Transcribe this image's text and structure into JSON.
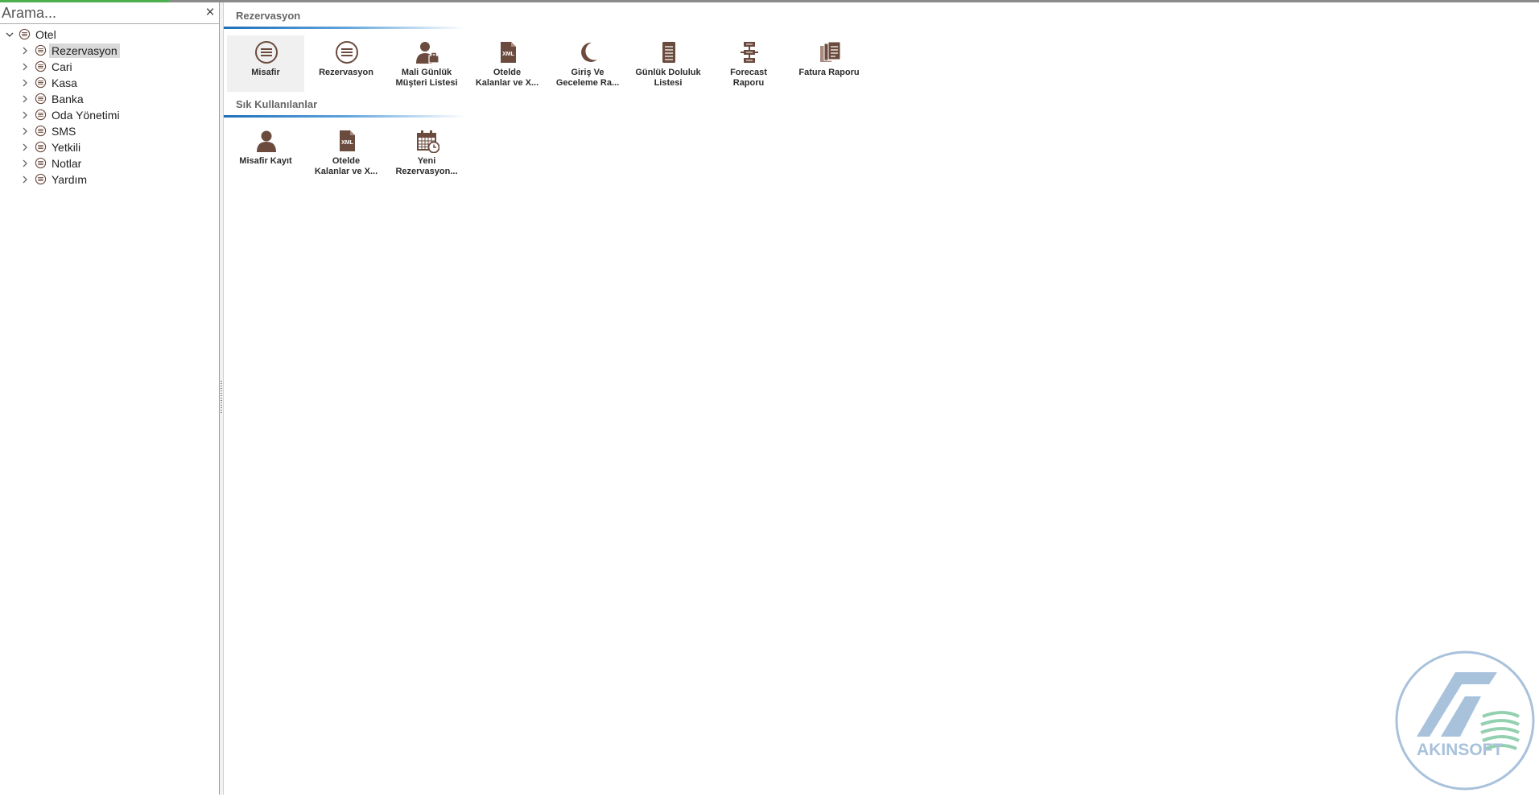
{
  "search": {
    "placeholder": "Arama...",
    "close_symbol": "×"
  },
  "tree": {
    "root": "Otel",
    "items": [
      {
        "label": "Rezervasyon",
        "selected": true
      },
      {
        "label": "Cari"
      },
      {
        "label": "Kasa"
      },
      {
        "label": "Banka"
      },
      {
        "label": "Oda Yönetimi"
      },
      {
        "label": "SMS"
      },
      {
        "label": "Yetkili"
      },
      {
        "label": "Notlar"
      },
      {
        "label": "Yardım"
      }
    ]
  },
  "sections": {
    "main": {
      "title": "Rezervasyon",
      "tiles": [
        {
          "line1": "Misafir",
          "line2": "",
          "icon": "list-circle-icon"
        },
        {
          "line1": "Rezervasyon",
          "line2": "",
          "icon": "list-circle-icon"
        },
        {
          "line1": "Mali Günlük",
          "line2": "Müşteri Listesi",
          "icon": "person-briefcase-icon"
        },
        {
          "line1": "Otelde",
          "line2": "Kalanlar ve X...",
          "icon": "xml-file-icon"
        },
        {
          "line1": "Giriş Ve",
          "line2": "Geceleme Ra...",
          "icon": "moon-icon"
        },
        {
          "line1": "Günlük Doluluk",
          "line2": "Listesi",
          "icon": "document-lines-icon"
        },
        {
          "line1": "Forecast",
          "line2": "Raporu",
          "icon": "forecast-icon"
        },
        {
          "line1": "Fatura Raporu",
          "line2": "",
          "icon": "invoice-stack-icon"
        }
      ]
    },
    "frequent": {
      "title": "Sık Kullanılanlar",
      "tiles": [
        {
          "line1": "Misafir Kayıt",
          "line2": "",
          "icon": "person-icon"
        },
        {
          "line1": "Otelde",
          "line2": "Kalanlar ve X...",
          "icon": "xml-file-icon"
        },
        {
          "line1": "Yeni",
          "line2": "Rezervasyon...",
          "icon": "calendar-clock-icon"
        }
      ]
    }
  },
  "logo": {
    "text": "AKINSOFT"
  },
  "colors": {
    "icon": "#6b4b3e",
    "accent": "#1f6fb8",
    "logo": "#a9c2dc",
    "logo_green": "#93d0b0"
  }
}
